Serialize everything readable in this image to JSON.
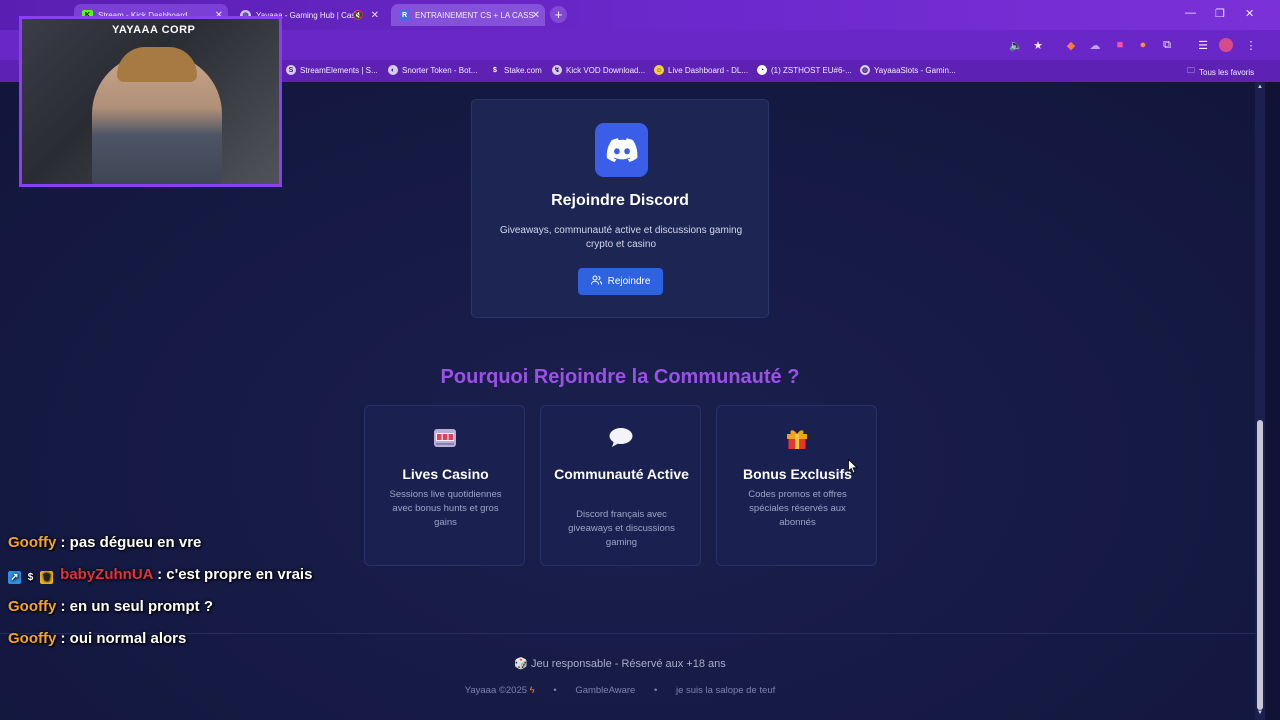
{
  "browser": {
    "tabs": [
      {
        "title": "Stream - Kick Dashboard",
        "icon": "kick-icon"
      },
      {
        "title": "Yayaaa - Gaming Hub | Cas",
        "icon": "globe-icon"
      },
      {
        "title": "ENTRAINEMENT CS + LA CASS",
        "icon": "r-icon"
      }
    ],
    "bookmarks": [
      {
        "label": "StreamElements | S...",
        "icon": "streamelements-icon"
      },
      {
        "label": "Snorter Token - Bot...",
        "icon": "snorter-icon"
      },
      {
        "label": "Stake.com",
        "icon": "stake-icon"
      },
      {
        "label": "Kick VOD Download...",
        "icon": "kick-vod-icon"
      },
      {
        "label": "Live Dashboard - DL...",
        "icon": "dlive-icon"
      },
      {
        "label": "(1) ZSTHOST EU#6-...",
        "icon": "zsthost-icon"
      },
      {
        "label": "YayaaaSlots - Gamin...",
        "icon": "globe-icon"
      }
    ],
    "all_favorites": "Tous les favoris"
  },
  "discord": {
    "title": "Rejoindre Discord",
    "desc": "Giveaways, communauté active et discussions gaming crypto et casino",
    "button": "Rejoindre",
    "accent": "#3b5ee8"
  },
  "why": {
    "title": "Pourquoi Rejoindre la Communauté ?",
    "color": "#9a52e6",
    "features": [
      {
        "icon": "slot-machine-icon",
        "title": "Lives Casino",
        "desc": "Sessions live quotidiennes avec bonus hunts et gros gains"
      },
      {
        "icon": "speech-bubble-icon",
        "title": "Communauté Active",
        "desc": "Discord français avec giveaways et discussions gaming"
      },
      {
        "icon": "gift-icon",
        "title": "Bonus Exclusifs",
        "desc": "Codes promos et offres spéciales réservés aux abonnés"
      }
    ]
  },
  "footer": {
    "responsible": "🎲 Jeu responsable - Réservé aux +18 ans",
    "copyright": "Yayaaa ©2025",
    "link1": "GambleAware",
    "link2": "je suis la salope de teuf"
  },
  "stream_overlay": {
    "webcam_label": "YAYAAA CORP",
    "chat": [
      {
        "user": "Gooffy",
        "message": " : pas dégueu en vre",
        "color": "#f3a528"
      },
      {
        "user": "babyZuhnUA",
        "message": " : c'est propre en vrais",
        "color": "#e1333f"
      },
      {
        "user": "Gooffy",
        "message": " : en un seul prompt ?",
        "color": "#f3a528"
      },
      {
        "user": "Gooffy",
        "message": " : oui normal alors",
        "color": "#f3a528"
      }
    ]
  }
}
